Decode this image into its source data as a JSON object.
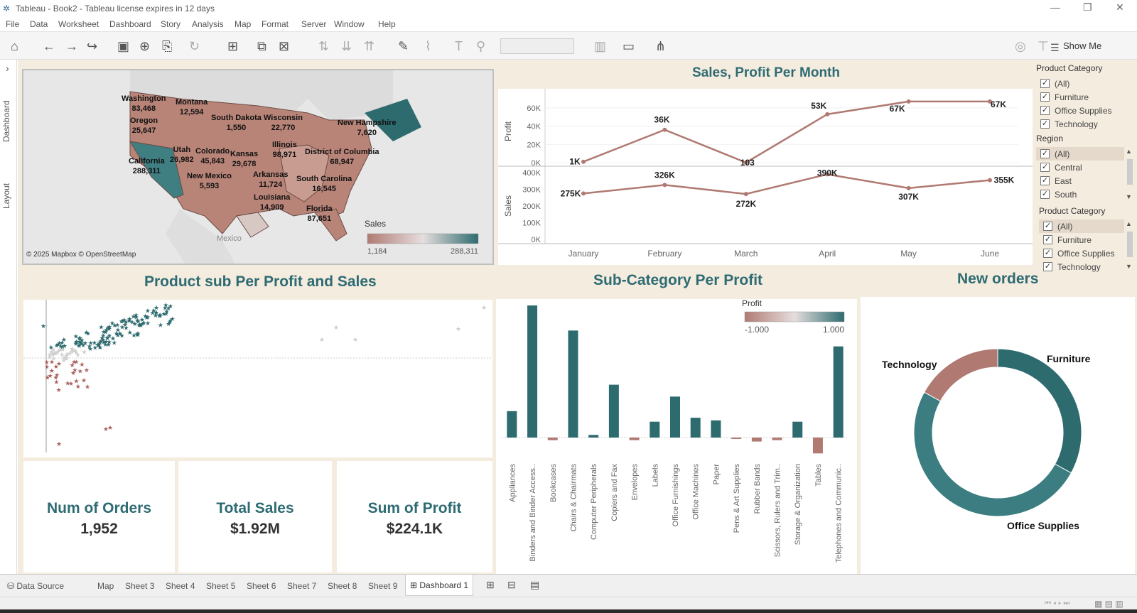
{
  "window": {
    "title": "Tableau - Book2 - Tableau license expires in 12 days",
    "minimize": "—",
    "restore": "❐",
    "close": "✕"
  },
  "menu": [
    "File",
    "Data",
    "Worksheet",
    "Dashboard",
    "Story",
    "Analysis",
    "Map",
    "Format",
    "Server",
    "Window",
    "Help"
  ],
  "toolbar": {
    "show_me": "Show Me",
    "icons": [
      "home-icon",
      "back-icon",
      "forward-icon",
      "redo-icon",
      "save-icon",
      "new-datasource-icon",
      "pause-icon",
      "refresh-icon",
      "new-sheet-icon",
      "duplicate-icon",
      "clear-icon",
      "swap-icon",
      "sort-asc-icon",
      "sort-desc-icon",
      "highlight-icon",
      "clip-icon",
      "text-icon",
      "pin-icon",
      "fit-icon",
      "presentation-icon",
      "share-icon"
    ]
  },
  "side_tabs": {
    "dashboard": "Dashboard",
    "layout": "Layout",
    "collapse": "›"
  },
  "map": {
    "legend_title": "Sales",
    "legend_min": "1,184",
    "legend_max": "288,311",
    "attribution": "© 2025 Mapbox © OpenStreetMap",
    "mexico": "Mexico",
    "states": [
      {
        "name": "Washington",
        "value": "83,468"
      },
      {
        "name": "Montana",
        "value": "12,594"
      },
      {
        "name": "Oregon",
        "value": "25,647"
      },
      {
        "name": "South Dakota",
        "value": "1,550"
      },
      {
        "name": "Wisconsin",
        "value": "22,770"
      },
      {
        "name": "New Hampshire",
        "value": "7,620"
      },
      {
        "name": "Illinois",
        "value": "98,971"
      },
      {
        "name": "District of Columbia",
        "value": "68,947"
      },
      {
        "name": "Utah",
        "value": "26,982"
      },
      {
        "name": "Colorado",
        "value": "45,843"
      },
      {
        "name": "Kansas",
        "value": "29,678"
      },
      {
        "name": "California",
        "value": "288,311"
      },
      {
        "name": "New Mexico",
        "value": "5,593"
      },
      {
        "name": "Arkansas",
        "value": "11,724"
      },
      {
        "name": "South Carolina",
        "value": "16,545"
      },
      {
        "name": "Louisiana",
        "value": "14,909"
      },
      {
        "name": "Florida",
        "value": "87,651"
      }
    ]
  },
  "sales_profit": {
    "title": "Sales, Profit Per Month"
  },
  "chart_data": [
    {
      "type": "line",
      "title": "Sales, Profit Per Month",
      "ylabel": "Profit",
      "x": [
        "January",
        "February",
        "March",
        "April",
        "May",
        "June"
      ],
      "values": [
        1000,
        36000,
        103,
        53000,
        67000,
        67000
      ],
      "labels": [
        "1K",
        "36K",
        "103",
        "53K",
        "67K",
        "67K"
      ],
      "ylim": [
        0,
        70000
      ],
      "ticks": [
        "60K",
        "40K",
        "20K",
        "0K"
      ],
      "color": "#b07a72"
    },
    {
      "type": "line",
      "ylabel": "Sales",
      "x": [
        "January",
        "February",
        "March",
        "April",
        "May",
        "June"
      ],
      "values": [
        275000,
        326000,
        272000,
        390000,
        307000,
        355000
      ],
      "labels": [
        "275K",
        "326K",
        "272K",
        "390K",
        "307K",
        "355K"
      ],
      "ylim": [
        0,
        400000
      ],
      "ticks": [
        "400K",
        "300K",
        "200K",
        "100K",
        "0K"
      ],
      "color": "#b07a72"
    },
    {
      "type": "bar",
      "title": "Sub-Category Per Profit",
      "categories": [
        "Appliances",
        "Binders and Binder Access..",
        "Bookcases",
        "Chairs & Chairmats",
        "Computer Peripherals",
        "Copiers and Fax",
        "Envelopes",
        "Labels",
        "Office Furnishings",
        "Office Machines",
        "Paper",
        "Pens & Art Supplies",
        "Rubber Bands",
        "Scissors, Rulers and Trim..",
        "Storage & Organization",
        "Tables",
        "Telephones and Communic.."
      ],
      "values": [
        0.2,
        1.0,
        -0.02,
        0.81,
        0.02,
        0.4,
        -0.02,
        0.12,
        0.31,
        0.15,
        0.13,
        -0.01,
        -0.03,
        -0.02,
        0.12,
        -0.12,
        0.69
      ],
      "legend_title": "Profit",
      "legend_min": "-1.000",
      "legend_max": "1.000"
    },
    {
      "type": "pie",
      "title": "New orders",
      "categories": [
        "Furniture",
        "Office Supplies",
        "Technology"
      ],
      "values": [
        0.33,
        0.5,
        0.17
      ],
      "colors": [
        "#2e6b6f",
        "#3b7d80",
        "#b07a72"
      ]
    },
    {
      "type": "scatter",
      "title": "Product sub Per Profit and Sales",
      "color_scale": [
        "#a9615d",
        "#d9d9d9",
        "#2e6b6f"
      ]
    }
  ],
  "subcat": {
    "title": "Sub-Category Per Profit"
  },
  "donut": {
    "title": "New orders",
    "labels": [
      "Technology",
      "Furniture",
      "Office Supplies"
    ]
  },
  "scatter": {
    "title": "Product sub Per Profit and Sales"
  },
  "kpis": [
    {
      "label": "Num of Orders",
      "value": "1,952"
    },
    {
      "label": "Total Sales",
      "value": "$1.92M"
    },
    {
      "label": "Sum of Profit",
      "value": "$224.1K"
    }
  ],
  "filters": {
    "category1": {
      "title": "Product Category",
      "items": [
        "(All)",
        "Furniture",
        "Office Supplies",
        "Technology"
      ]
    },
    "region": {
      "title": "Region",
      "items": [
        "(All)",
        "Central",
        "East",
        "South"
      ]
    },
    "category2": {
      "title": "Product Category",
      "items": [
        "(All)",
        "Furniture",
        "Office Supplies",
        "Technology"
      ]
    }
  },
  "tabs": [
    "Data Source",
    "Map",
    "Sheet 3",
    "Sheet 4",
    "Sheet 5",
    "Sheet 6",
    "Sheet 7",
    "Sheet 8",
    "Sheet 9",
    "Dashboard 1"
  ]
}
